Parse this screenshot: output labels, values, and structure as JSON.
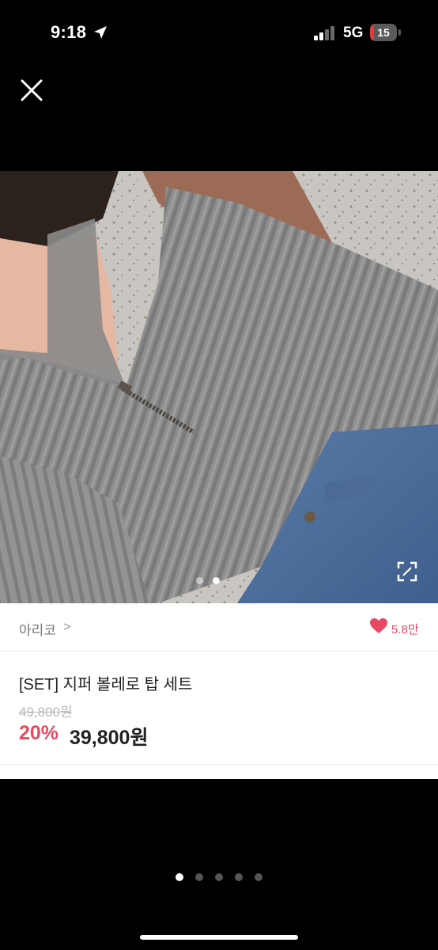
{
  "status_bar": {
    "time": "9:18",
    "network": "5G",
    "battery_level": "15",
    "icons": [
      "location-arrow-icon",
      "signal-icon",
      "battery-icon"
    ]
  },
  "viewer": {
    "close_icon": "close-icon",
    "expand_icon": "expand-icon",
    "image_dots_count": 2,
    "image_active_dot": 2
  },
  "product": {
    "shop_name": "아리코",
    "shop_chevron": ">",
    "like_count": "5.8만",
    "title": "[SET] 지퍼 볼레로 탑 세트",
    "original_price": "49,800원",
    "discount": "20%",
    "sale_price": "39,800원"
  },
  "pager": {
    "count": 5,
    "active": 1
  },
  "colors": {
    "accent": "#e84a63",
    "battery_low": "#e0393a"
  }
}
